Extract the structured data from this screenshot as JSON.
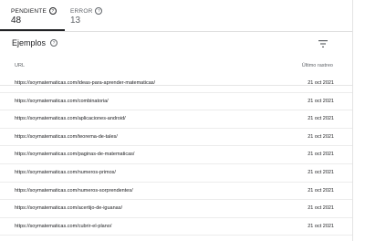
{
  "tabs": [
    {
      "label": "PENDIENTE",
      "count": "48"
    },
    {
      "label": "ERROR",
      "count": "13"
    }
  ],
  "section": {
    "title": "Ejemplos"
  },
  "table": {
    "columns": {
      "url": "URL",
      "date": "Último rastreo"
    },
    "rows": [
      {
        "url": "https://soymatematicas.com/ideas-para-aprender-matematicas/",
        "date": "21 oct 2021"
      },
      {
        "url": "https://soymatematicas.com/combinatoria/",
        "date": "21 oct 2021"
      },
      {
        "url": "https://soymatematicas.com/aplicaciones-android/",
        "date": "21 oct 2021"
      },
      {
        "url": "https://soymatematicas.com/teorema-de-tales/",
        "date": "21 oct 2021"
      },
      {
        "url": "https://soymatematicas.com/paginas-de-matematicas/",
        "date": "21 oct 2021"
      },
      {
        "url": "https://soymatematicas.com/numeros-primos/",
        "date": "21 oct 2021"
      },
      {
        "url": "https://soymatematicas.com/numeros-sorprendentes/",
        "date": "21 oct 2021"
      },
      {
        "url": "https://soymatematicas.com/acertijo-de-iguanas/",
        "date": "21 oct 2021"
      },
      {
        "url": "https://soymatematicas.com/cubrir-el-plano/",
        "date": "21 oct 2021"
      }
    ]
  },
  "icons": {
    "help": "help-circle-icon",
    "filter": "filter-icon"
  }
}
